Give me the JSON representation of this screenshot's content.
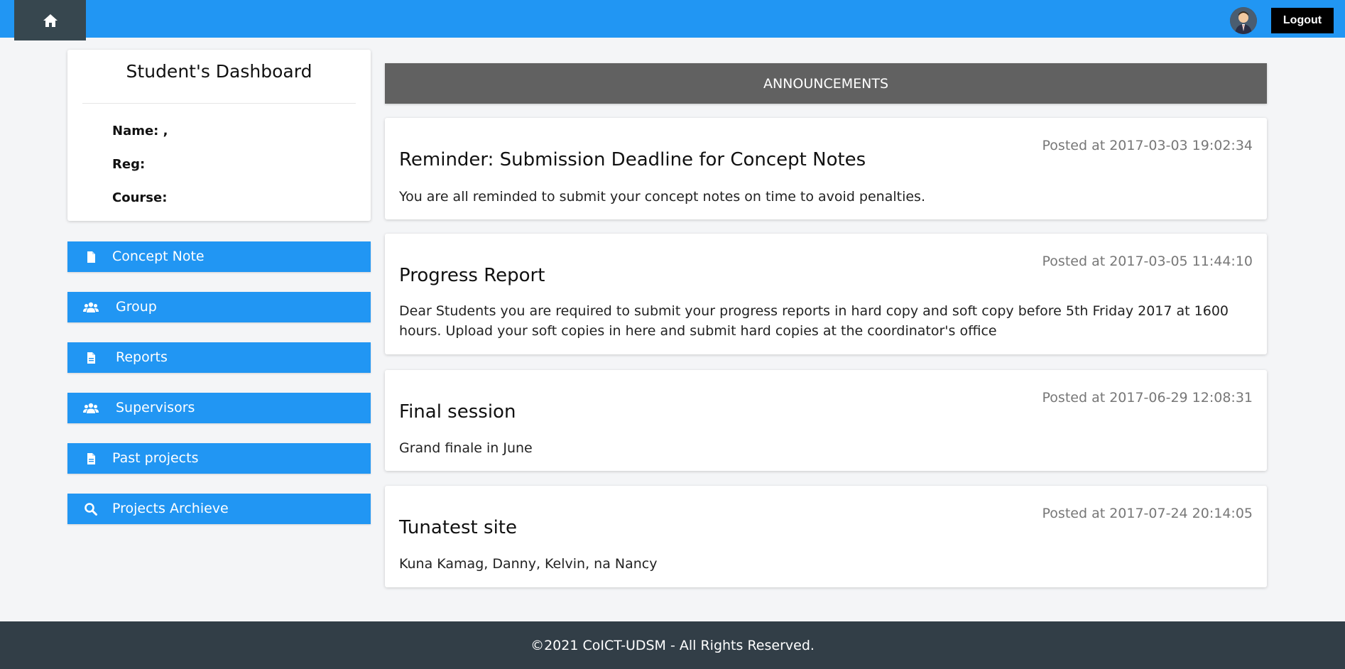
{
  "header": {
    "home_icon": "home-icon",
    "avatar_icon": "user-avatar",
    "logout_label": "Logout",
    "brand_color": "#2196f3"
  },
  "profile": {
    "title": "Student's Dashboard",
    "name_label": "Name: ,",
    "reg_label": "Reg:",
    "course_label": "Course:"
  },
  "sidebar": {
    "items": [
      {
        "label": "Concept Note",
        "icon": "file-icon"
      },
      {
        "label": "Group",
        "icon": "users-icon"
      },
      {
        "label": "Reports",
        "icon": "file-icon"
      },
      {
        "label": "Supervisors",
        "icon": "users-icon"
      },
      {
        "label": "Past projects",
        "icon": "file-icon"
      },
      {
        "label": "Projects Archieve",
        "icon": "search-icon"
      }
    ]
  },
  "announcements": {
    "header": "ANNOUNCEMENTS",
    "items": [
      {
        "title": "Reminder: Submission Deadline for Concept Notes",
        "date": "Posted at 2017-03-03 19:02:34",
        "body": "You are all reminded to submit your concept notes on time to avoid penalties."
      },
      {
        "title": "Progress Report",
        "date": "Posted at 2017-03-05 11:44:10",
        "body": "Dear Students you are required to submit your progress reports in hard copy and soft copy before 5th Friday 2017 at 1600 hours. Upload your soft copies in here and submit hard copies at the coordinator's office"
      },
      {
        "title": "Final session",
        "date": "Posted at 2017-06-29 12:08:31",
        "body": "Grand finale in June"
      },
      {
        "title": "Tunatest site",
        "date": "Posted at 2017-07-24 20:14:05",
        "body": "Kuna Kamag, Danny, Kelvin, na Nancy"
      }
    ]
  },
  "footer": {
    "text": "©2021 CoICT-UDSM - All Rights Reserved."
  }
}
